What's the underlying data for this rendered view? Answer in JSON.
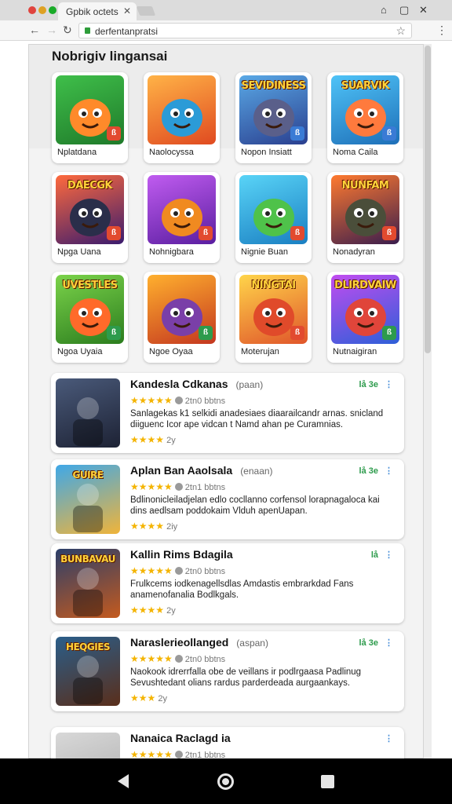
{
  "browser": {
    "tab_title": "Gpbik octets",
    "url": "derfentanpratsi"
  },
  "section_title": "Nobrigiv lingansai",
  "tiles": [
    {
      "label": "Nplatdana",
      "art_text": "",
      "badge": "ß",
      "badge_color": "#e24a2f"
    },
    {
      "label": "Naolocyssa",
      "art_text": "",
      "badge": "",
      "badge_color": "#e24a2f"
    },
    {
      "label": "Nopon Insiatt",
      "art_text": "SEVIDINESS",
      "badge": "ß",
      "badge_color": "#3a7bd5"
    },
    {
      "label": "Noma Caila",
      "art_text": "SUARVIK",
      "badge": "ß",
      "badge_color": "#3a7bd5"
    },
    {
      "label": "Npga Uana",
      "art_text": "DAECGK",
      "badge": "ß",
      "badge_color": "#e24a2f"
    },
    {
      "label": "Nohnigbara",
      "art_text": "",
      "badge": "ß",
      "badge_color": "#e24a2f"
    },
    {
      "label": "Nignie Buan",
      "art_text": "",
      "badge": "ß",
      "badge_color": "#e24a2f"
    },
    {
      "label": "Nonadyran",
      "art_text": "NUNFAM",
      "badge": "ß",
      "badge_color": "#e24a2f"
    },
    {
      "label": "Ngoa Uyaia",
      "art_text": "UVESTLES",
      "badge": "ß",
      "badge_color": "#2d9b4c"
    },
    {
      "label": "Ngoe Oyaa",
      "art_text": "",
      "badge": "ß",
      "badge_color": "#2d9b4c"
    },
    {
      "label": "Moterujan",
      "art_text": "NINGTAI",
      "badge": "ß",
      "badge_color": "#e24a2f"
    },
    {
      "label": "Nutnaigiran",
      "art_text": "DLIRDVAIW",
      "badge": "ß",
      "badge_color": "#2d9b4c"
    }
  ],
  "cards": [
    {
      "title": "Kandesla Cdkanas",
      "tag": "(paan)",
      "stars": "★★★★★",
      "rating_text": "2tn0 bbtns",
      "desc": "Sanlagekas k1 selkidi anadesiaes diaarailcandr arnas. snicland diiguenc Icor ape vidcan t Namd ahan pe Curamnias.",
      "bottom_stars": "★★★★",
      "bottom_text": "2y",
      "actions": "lå 3e",
      "art_text": ""
    },
    {
      "title": "Aplan Ban Aaolsala",
      "tag": "(enaan)",
      "stars": "★★★★★",
      "rating_text": "2tn1 bbtns",
      "desc": "Bdlinonicleiladjelan edlo cocllanno corfensol lorapnagaloca  kai dins aedlsam poddokaim Vlduh apenUapan.",
      "bottom_stars": "★★★★",
      "bottom_text": "2iy",
      "actions": "lå 3e",
      "art_text": "GUIRE"
    },
    {
      "title": "Kallin Rims Bdagila",
      "tag": "",
      "stars": "★★★★★",
      "rating_text": "2tn0 bbtns",
      "desc": "Frulkcems iodkenagellsdlas  Amdastis embrarkdad Fans anamenofanalia  Bodlkgals.",
      "bottom_stars": "★★★★",
      "bottom_text": "2y",
      "actions": "lå",
      "art_text": "BUNBAVAU"
    },
    {
      "title": "Naraslerieollanged",
      "tag": "(aspan)",
      "stars": "★★★★★",
      "rating_text": "2tn0 bbtns",
      "desc": "Naokook idrerrfalla obe de veillans ir podlrgaasa Padlinug Sevushtedant olians rardus parderdeada aurgaankays.",
      "bottom_stars": "★★★",
      "bottom_text": "2y",
      "actions": "lå 3e",
      "art_text": "HEQGIES"
    },
    {
      "title": "Nanaica Raclagd ia",
      "tag": "",
      "stars": "★★★★★",
      "rating_text": "2tn1 bbtns",
      "desc": "",
      "bottom_stars": "",
      "bottom_text": "",
      "actions": "",
      "art_text": ""
    }
  ],
  "colors": {
    "accent_green": "#2d9b4c",
    "accent_blue": "#4a90d9",
    "star_gold": "#f4b400"
  }
}
